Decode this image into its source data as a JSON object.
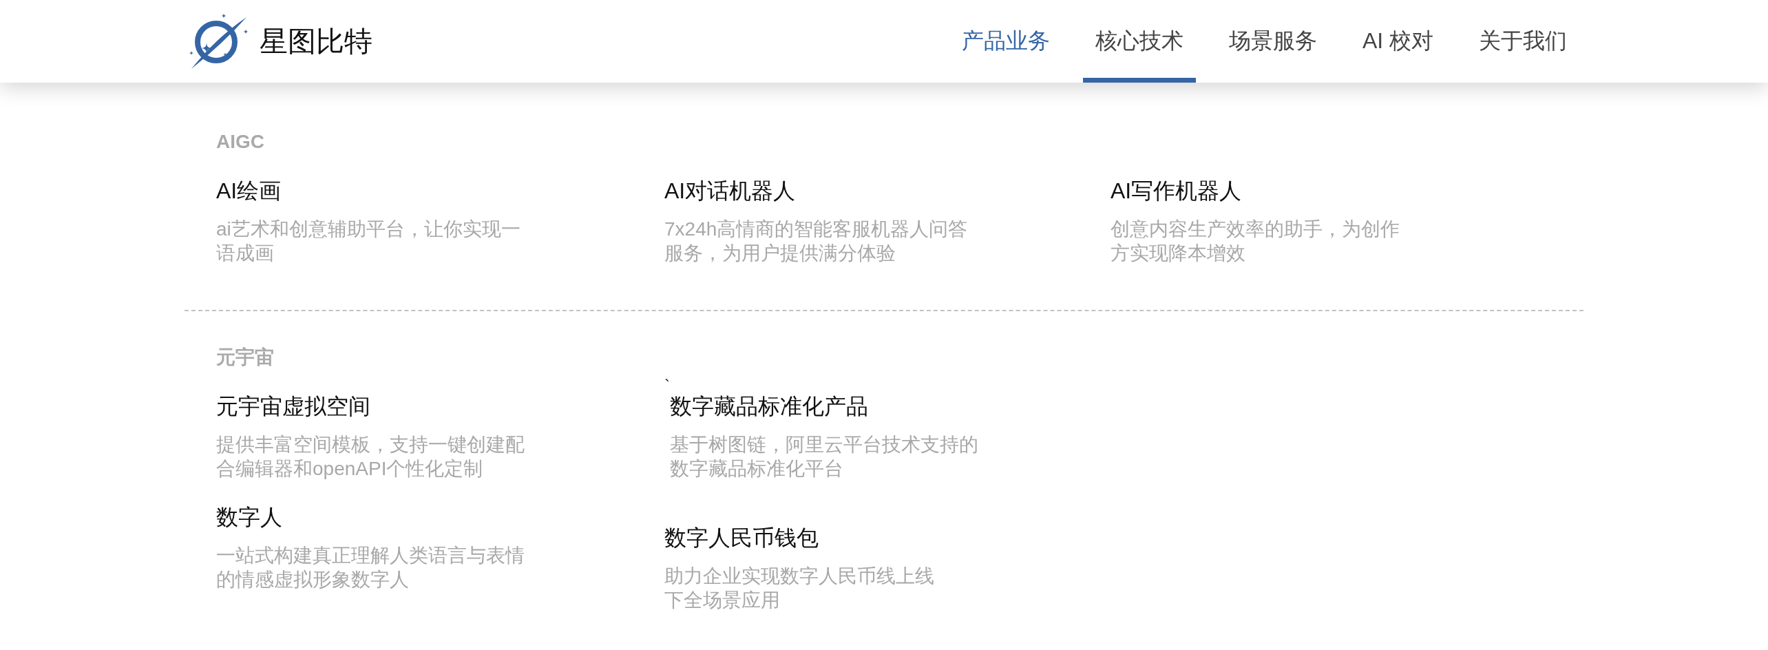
{
  "header": {
    "brand": "星图比特",
    "nav": [
      {
        "label": "产品业务",
        "selected": false,
        "expanded": true
      },
      {
        "label": "核心技术",
        "selected": true,
        "expanded": false
      },
      {
        "label": "场景服务",
        "selected": false,
        "expanded": false
      },
      {
        "label": "AI 校对",
        "selected": false,
        "expanded": false
      },
      {
        "label": "关于我们",
        "selected": false,
        "expanded": false
      }
    ]
  },
  "menu": {
    "sections": [
      {
        "heading": "AIGC",
        "columns": [
          {
            "items": [
              {
                "title": "AI绘画",
                "description": "ai艺术和创意辅助平台，让你实现一语成画"
              }
            ]
          },
          {
            "items": [
              {
                "title": "AI对话机器人",
                "description": "7x24h高情商的智能客服机器人问答服务，为用户提供满分体验"
              }
            ]
          },
          {
            "items": [
              {
                "title": "AI写作机器人",
                "description": "创意内容生产效率的助手，为创作方实现降本增效"
              }
            ]
          }
        ]
      },
      {
        "heading": "元宇宙",
        "columns": [
          {
            "items": [
              {
                "title": "元宇宙虚拟空间",
                "description": "提供丰富空间模板，支持一键创建配合编辑器和openAPI个性化定制"
              },
              {
                "title": "数字人",
                "description": "一站式构建真正理解人类语言与表情的情感虚拟形象数字人"
              }
            ]
          },
          {
            "items": [
              {
                "prefix": "`",
                "title": "数字藏品标准化产品",
                "description": "基于树图链，阿里云平台技术支持的数字藏品标准化平台"
              },
              {
                "title": "数字人民币钱包",
                "description": "助力企业实现数字人民币线上线下全场景应用"
              }
            ]
          }
        ]
      }
    ]
  }
}
